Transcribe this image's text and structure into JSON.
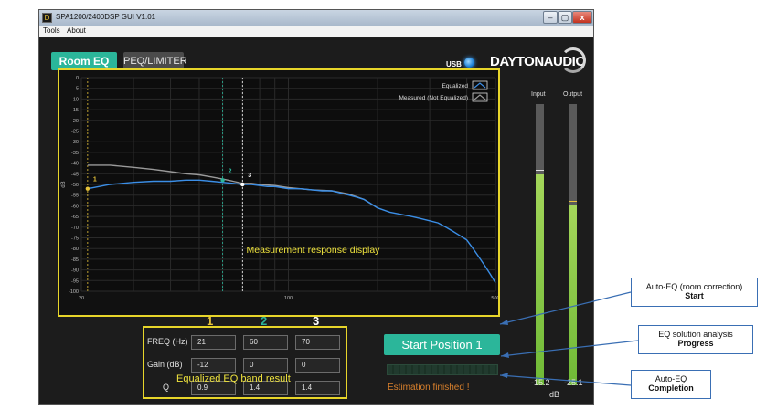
{
  "window": {
    "title": "SPA1200/2400DSP GUI V1.01",
    "minimize": "–",
    "maximize": "▢",
    "close": "x"
  },
  "menu": [
    "Tools",
    "About"
  ],
  "tabs": [
    {
      "label": "Room EQ",
      "active": true
    },
    {
      "label": "PEQ/LIMITER",
      "active": false
    }
  ],
  "usb": {
    "label": "USB",
    "led_color": "#1a7fd6"
  },
  "logo": {
    "text": "DAYTONAUDIO"
  },
  "chart_data": {
    "type": "line",
    "ylabel": "dB",
    "x_scale": "log",
    "xlim": [
      20,
      500
    ],
    "x_ticks": [
      "20",
      "100",
      "500"
    ],
    "ylim": [
      -100,
      0
    ],
    "y_ticks": [
      "0",
      "-5",
      "-10",
      "-15",
      "-20",
      "-25",
      "-30",
      "-35",
      "-40",
      "-45",
      "-50",
      "-55",
      "-60",
      "-65",
      "-70",
      "-75",
      "-80",
      "-85",
      "-90",
      "-95",
      "-100"
    ],
    "grid": true,
    "legend": {
      "position": "top-right",
      "entries": [
        "Equalized",
        "Measured (Not Equalized)"
      ]
    },
    "series": [
      {
        "name": "Equalized",
        "color": "#3b8ee6",
        "x": [
          21,
          25,
          30,
          35,
          40,
          45,
          50,
          55,
          60,
          65,
          70,
          75,
          80,
          85,
          90,
          95,
          100,
          110,
          120,
          130,
          140,
          150,
          160,
          170,
          180,
          190,
          200,
          220,
          240,
          260,
          280,
          300,
          320,
          340,
          360,
          380,
          400,
          420,
          440,
          460,
          480,
          500
        ],
        "y": [
          -52,
          -50,
          -49,
          -48.5,
          -48.5,
          -48,
          -48,
          -48.5,
          -49,
          -49.5,
          -50,
          -50,
          -50.5,
          -51,
          -51,
          -51.5,
          -52,
          -52,
          -52.5,
          -53,
          -53,
          -54,
          -55,
          -56,
          -57,
          -59,
          -61,
          -63,
          -64,
          -65,
          -66,
          -67,
          -68,
          -70,
          -72,
          -74,
          -76,
          -80,
          -84,
          -88,
          -92,
          -96
        ]
      },
      {
        "name": "Measured (Not Equalized)",
        "color": "#9a9a9a",
        "x": [
          21,
          25,
          30,
          35,
          40,
          45,
          50,
          55,
          60,
          65,
          70,
          75,
          80,
          90,
          100,
          120,
          140,
          160,
          180,
          200
        ],
        "y": [
          -41,
          -41,
          -42,
          -43,
          -44,
          -45,
          -45.5,
          -46.5,
          -47.5,
          -48.5,
          -49.5,
          -49.5,
          -50,
          -50.5,
          -51.5,
          -52.5,
          -53,
          -54.5,
          -57,
          -61
        ]
      }
    ],
    "band_markers": [
      {
        "label": "1",
        "freq": 21,
        "gain": -52,
        "color": "#e8c43a"
      },
      {
        "label": "2",
        "freq": 60,
        "gain": -48,
        "color": "#2bb69a"
      },
      {
        "label": "3",
        "freq": 70,
        "gain": -50,
        "color": "#ffffff"
      }
    ],
    "annotation": "Measurement response display"
  },
  "meters": {
    "input": {
      "label": "Input",
      "value": "-15.2",
      "level": 0.75,
      "peak_color": "#e2e2e2"
    },
    "output": {
      "label": "Output",
      "value": "-25.1",
      "level": 0.64,
      "peak_color": "#e8c43a"
    },
    "unit": "dB"
  },
  "eq": {
    "band_numbers": [
      "1",
      "2",
      "3"
    ],
    "band_colors": [
      "#e8c43a",
      "#2bb69a",
      "#ffffff"
    ],
    "rows": [
      {
        "label": "FREQ (Hz)",
        "values": [
          "21",
          "60",
          "70"
        ]
      },
      {
        "label": "Gain (dB)",
        "values": [
          "-12",
          "0",
          "0"
        ]
      },
      {
        "label": "Q",
        "values": [
          "0.9",
          "1.4",
          "1.4"
        ]
      }
    ],
    "caption": "Equalized EQ band result"
  },
  "controls": {
    "start_label": "Start Position 1",
    "progress": 1.0,
    "status": "Estimation finished !"
  },
  "annotations": [
    {
      "line1": "Auto-EQ (room correction)",
      "line2": "Start"
    },
    {
      "line1": "EQ solution analysis",
      "line2": "Progress"
    },
    {
      "line1": "Auto-EQ",
      "line2": "Completion"
    }
  ]
}
